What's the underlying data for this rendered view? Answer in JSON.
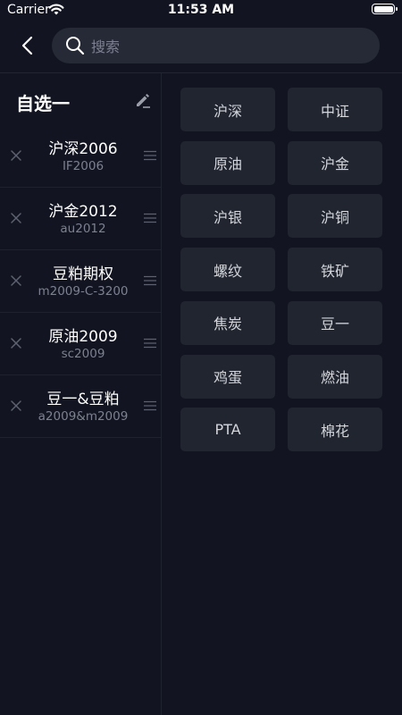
{
  "status_bar": {
    "carrier": "Carrier",
    "time": "11:53 AM",
    "battery_icon": "battery-full-icon",
    "wifi_icon": "wifi-icon"
  },
  "nav": {
    "back_icon": "chevron-left-icon",
    "search": {
      "placeholder": "搜索",
      "value": ""
    }
  },
  "group": {
    "title": "自选一",
    "edit_icon": "pencil-icon"
  },
  "watchlist": [
    {
      "name": "沪深2006",
      "code": "IF2006"
    },
    {
      "name": "沪金2012",
      "code": "au2012"
    },
    {
      "name": "豆粕期权",
      "code": "m2009-C-3200"
    },
    {
      "name": "原油2009",
      "code": "sc2009"
    },
    {
      "name": "豆一&豆粕",
      "code": "a2009&m2009"
    }
  ],
  "tags": [
    "沪深",
    "中证",
    "原油",
    "沪金",
    "沪银",
    "沪铜",
    "螺纹",
    "铁矿",
    "焦炭",
    "豆一",
    "鸡蛋",
    "燃油",
    "PTA",
    "棉花"
  ],
  "colors": {
    "background": "#121521",
    "search_bg": "#262a37",
    "tag_bg": "#21252f",
    "secondary_text": "#7c8090"
  }
}
